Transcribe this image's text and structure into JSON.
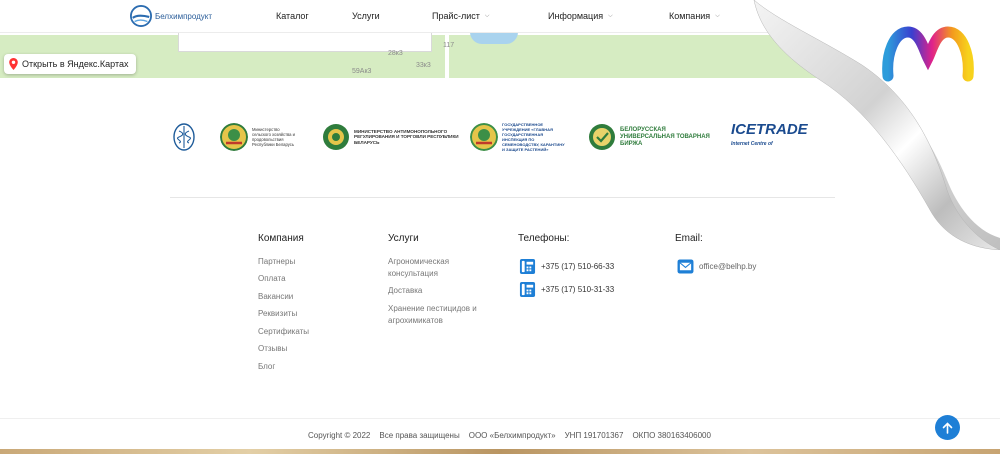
{
  "header": {
    "logo_text": "Белхимпродукт",
    "nav": [
      {
        "label": "Каталог"
      },
      {
        "label": "Услуги"
      },
      {
        "label": "Прайс-лист"
      },
      {
        "label": "Информация"
      },
      {
        "label": "Компания"
      }
    ]
  },
  "map": {
    "open_label": "Открыть в Яндекс.Картах",
    "labels": [
      "117",
      "28к3",
      "33к3",
      "59Ак3"
    ]
  },
  "partners": [
    {
      "text": ""
    },
    {
      "text": "Министерство сельского хозяйства и продовольствия Республики Беларусь"
    },
    {
      "text": "МИНИСТЕРСТВО АНТИМОНОПОЛЬНОГО РЕГУЛИРОВАНИЯ И ТОРГОВЛИ РЕСПУБЛИКИ БЕЛАРУСЬ"
    },
    {
      "text": "ГОСУДАРСТВЕННОЕ УЧРЕЖДЕНИЕ «ГЛАВНАЯ ГОСУДАРСТВЕННАЯ ИНСПЕКЦИЯ ПО СЕМЕНОВОДСТВУ, КАРАНТИНУ И ЗАЩИТЕ РАСТЕНИЙ»"
    },
    {
      "text": "БЕЛОРУССКАЯ УНИВЕРСАЛЬНАЯ ТОВАРНАЯ БИРЖА"
    },
    {
      "text": "ICETRADE",
      "sub": "Internet Centre of"
    }
  ],
  "footer": {
    "company": {
      "title": "Компания",
      "links": [
        "Партнеры",
        "Оплата",
        "Вакансии",
        "Реквизиты",
        "Сертификаты",
        "Отзывы",
        "Блог"
      ]
    },
    "services": {
      "title": "Услуги",
      "links": [
        "Агрономическая консультация",
        "Доставка",
        "Хранение пестицидов и агрохимикатов"
      ]
    },
    "phones": {
      "title": "Телефоны:",
      "items": [
        "+375 (17) 510-66-33",
        "+375 (17) 510-31-33"
      ]
    },
    "email": {
      "title": "Email:",
      "value": "office@belhp.by"
    }
  },
  "bottom": {
    "copyright": "Copyright © 2022",
    "rights": "Все права защищены",
    "company": "ООО «Белхимпродукт»",
    "unp": "УНП 191701367",
    "okpo": "ОКПО 380163406000"
  },
  "colors": {
    "accent": "#1e7fd6",
    "map_green": "#d6ecc2",
    "logo_blue": "#2b5e9a"
  },
  "icons": {
    "map_pin": "map-pin-icon",
    "phone": "phone-icon",
    "mail": "mail-icon",
    "scroll_up": "arrow-up-icon"
  }
}
